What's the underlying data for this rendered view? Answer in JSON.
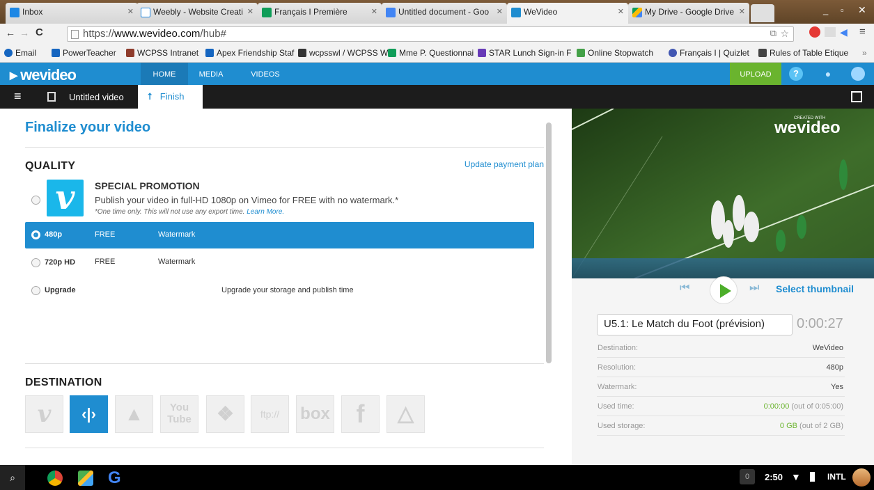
{
  "browser": {
    "tabs": [
      {
        "label": "Inbox",
        "color": "#1e88e5"
      },
      {
        "label": "Weebly - Website Creati",
        "color": "#1e88e5"
      },
      {
        "label": "Français I Première",
        "color": "#0f9d58"
      },
      {
        "label": "Untitled document - Goo",
        "color": "#4285f4"
      },
      {
        "label": "WeVideo",
        "color": "#1f8dd0"
      },
      {
        "label": "My Drive - Google Drive",
        "color": "#fbbc05"
      }
    ],
    "url_prefix": "https://",
    "url_host": "www.wevideo.com",
    "url_path": "/hub#",
    "bookmarks": [
      "Email",
      "PowerTeacher",
      "WCPSS Intranet",
      "Apex Friendship Staf",
      "wcpsswl / WCPSS W",
      "Mme P. Questionnai",
      "STAR Lunch Sign-in F",
      "Online Stopwatch",
      "Français I | Quizlet",
      "Rules of Table Etique"
    ]
  },
  "app": {
    "logo": "wevideo",
    "nav": [
      "HOME",
      "MEDIA",
      "VIDEOS"
    ],
    "upload_label": "UPLOAD",
    "help_glyph": "?",
    "accent": "#1f8dd0",
    "upload_color": "#6ab42e"
  },
  "editor": {
    "project_title": "Untitled video",
    "finish_label": "Finish"
  },
  "finalize": {
    "title": "Finalize your video",
    "quality_heading": "QUALITY",
    "update_plan": "Update payment plan",
    "promo_logo": "v",
    "promo_title": "SPECIAL PROMOTION",
    "promo_desc": "Publish your video in full-HD 1080p on Vimeo for FREE with no watermark.*",
    "promo_note": "*One time only. This will not use any export time.",
    "promo_learn": "Learn More.",
    "options": [
      {
        "name": "480p",
        "price": "FREE",
        "watermark": "Watermark",
        "selected": true
      },
      {
        "name": "720p HD",
        "price": "FREE",
        "watermark": "Watermark",
        "selected": false
      },
      {
        "name": "Upgrade",
        "note": "Upgrade your storage and publish time",
        "selected": false
      }
    ],
    "destination_heading": "DESTINATION",
    "destinations": [
      "vimeo",
      "wevideo",
      "google-classroom",
      "youtube",
      "dropbox",
      "ftp",
      "box",
      "facebook",
      "google-drive"
    ],
    "dest_labels": {
      "vimeo": "v",
      "wevideo": "‹|›",
      "youtube_top": "You",
      "youtube_bottom": "Tube",
      "ftp": "ftp://",
      "box": "box",
      "facebook": "f"
    }
  },
  "preview": {
    "watermark_small": "CREATED WITH",
    "watermark": "wevideo",
    "select_thumbnail": "Select thumbnail",
    "video_title": "U5.1: Le Match du Foot (prévision)",
    "duration": "0:00:27",
    "info": [
      {
        "label": "Destination:",
        "value": "WeVideo"
      },
      {
        "label": "Resolution:",
        "value": "480p"
      },
      {
        "label": "Watermark:",
        "value": "Yes"
      },
      {
        "label": "Used time:",
        "value_highlight": "0:00:00",
        "value_rest": " (out of 0:05:00)"
      },
      {
        "label": "Used storage:",
        "value_highlight": "0 GB",
        "value_rest": " (out of 2 GB)"
      }
    ]
  },
  "taskbar": {
    "notifications": "0",
    "time": "2:50",
    "ime": "INTL"
  }
}
